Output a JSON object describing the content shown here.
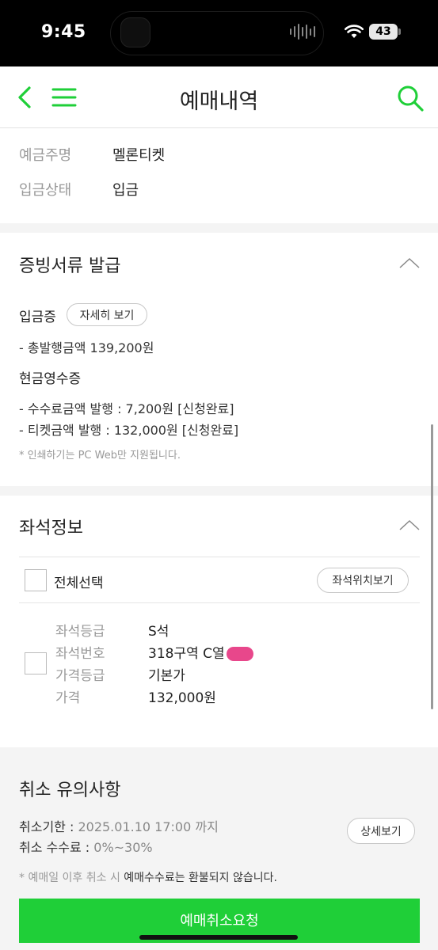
{
  "status_bar": {
    "time": "9:45",
    "battery": "43"
  },
  "header": {
    "title": "예매내역"
  },
  "deposit_info": {
    "rows": [
      {
        "label": "예금주명",
        "value": "멜론티켓"
      },
      {
        "label": "입금상태",
        "value": "입금"
      }
    ]
  },
  "proof_docs": {
    "title": "증빙서류 발급",
    "deposit_cert_label": "입금증",
    "detail_button": "자세히 보기",
    "total_amount_line": "- 총발행금액 139,200원",
    "cash_receipt_label": "현금영수증",
    "fee_line": "- 수수료금액 발행 : 7,200원 [신청완료]",
    "ticket_line": "- 티켓금액 발행 : 132,000원 [신청완료]",
    "print_note": "* 인쇄하기는 PC Web만 지원됩니다."
  },
  "seat_info": {
    "title": "좌석정보",
    "select_all_label": "전체선택",
    "seat_map_button": "좌석위치보기",
    "rows": [
      {
        "label": "좌석등급",
        "value": "S석"
      },
      {
        "label": "좌석번호",
        "value": "318구역 C열"
      },
      {
        "label": "가격등급",
        "value": "기본가"
      },
      {
        "label": "가격",
        "value": "132,000원"
      }
    ]
  },
  "cancel_notice": {
    "title": "취소 유의사항",
    "deadline_label": "취소기한 :",
    "deadline_value": "2025.01.10 17:00 까지",
    "fee_label": "취소 수수료 :",
    "fee_value": "0%~30%",
    "detail_button": "상세보기",
    "note_prefix": "* 예매일 이후 취소 시 ",
    "note_emphasis": "예매수수료는 환불되지 않습니다.",
    "cancel_button": "예매취소요청"
  },
  "colors": {
    "accent": "#1fcf38",
    "redaction": "#e8478b"
  },
  "icons": [
    "back-chevron-icon",
    "hamburger-menu-icon",
    "search-icon",
    "chevron-up-icon",
    "wifi-icon",
    "battery-icon"
  ]
}
